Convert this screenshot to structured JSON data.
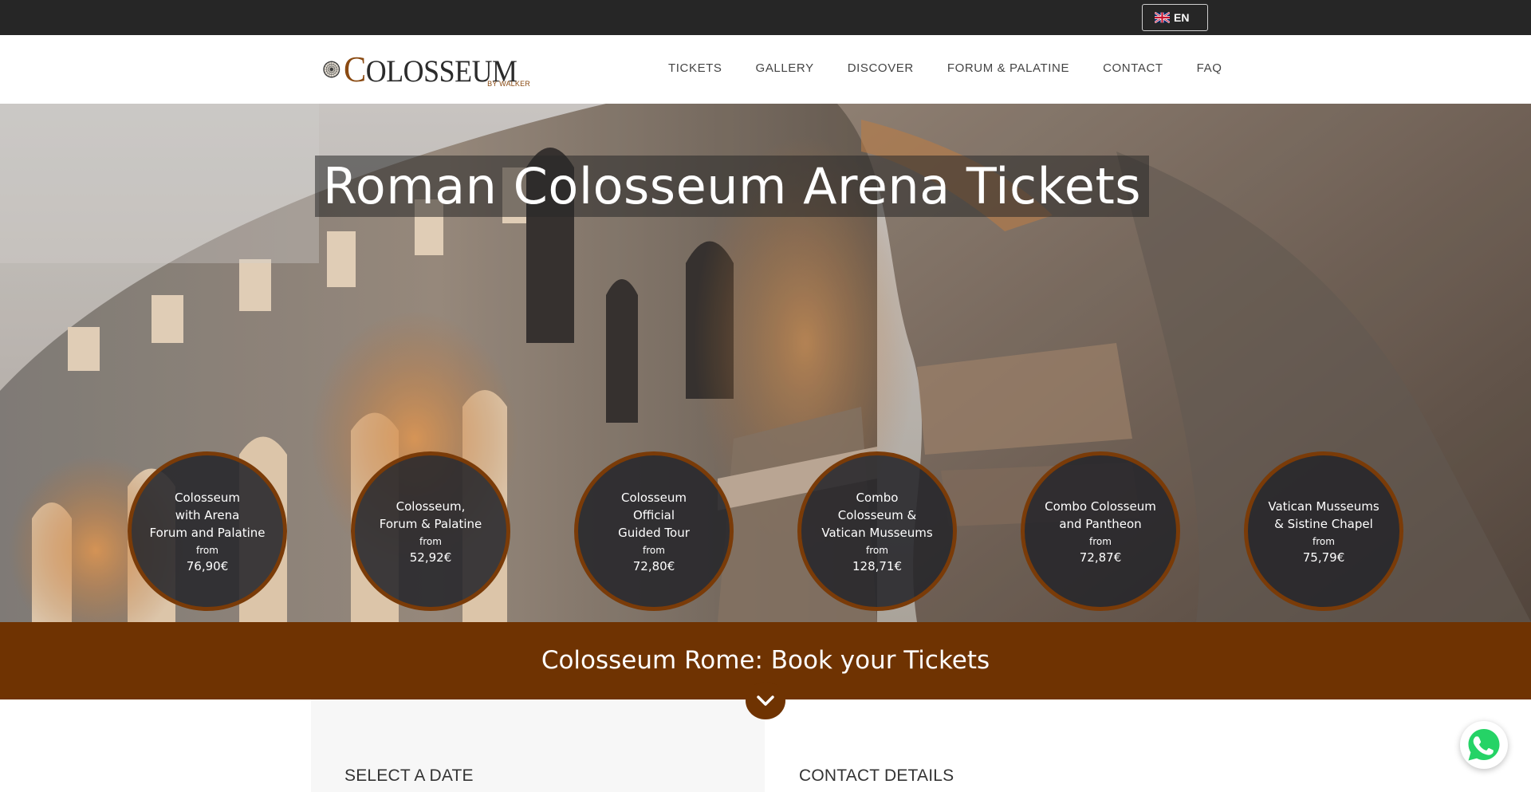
{
  "topbar": {
    "language": {
      "code": "EN",
      "flag_icon": "uk-flag-icon"
    }
  },
  "logo": {
    "initial": "C",
    "word_rest": "OLOSSEUM",
    "tagline": "BY WALKER",
    "brand_color": "#8a4a12"
  },
  "nav": {
    "items": [
      {
        "label": "TICKETS"
      },
      {
        "label": "GALLERY"
      },
      {
        "label": "DISCOVER"
      },
      {
        "label": "FORUM & PALATINE"
      },
      {
        "label": "CONTACT"
      },
      {
        "label": "FAQ"
      }
    ]
  },
  "hero": {
    "title": "Roman Colosseum Arena Tickets",
    "tickets": [
      {
        "title": "Colosseum\nwith Arena\nForum and Palatine",
        "from": "from",
        "price": "76,90€"
      },
      {
        "title": "Colosseum,\nForum & Palatine",
        "from": "from",
        "price": "52,92€"
      },
      {
        "title": "Colosseum\nOfficial\nGuided Tour",
        "from": "from",
        "price": "72,80€"
      },
      {
        "title": "Combo\nColosseum &\nVatican Musseums",
        "from": "from",
        "price": "128,71€"
      },
      {
        "title": "Combo Colosseum\nand Pantheon",
        "from": "from",
        "price": "72,87€"
      },
      {
        "title": "Vatican Musseums\n& Sistine Chapel",
        "from": "from",
        "price": "75,79€"
      }
    ]
  },
  "band": {
    "title": "Colosseum Rome: Book your Tickets",
    "color": "#6f3302",
    "scroll_icon": "chevron-down-icon"
  },
  "form": {
    "select_date_heading": "SELECT A DATE",
    "contact_heading": "CONTACT DETAILS"
  },
  "whatsapp": {
    "icon": "whatsapp-icon",
    "color": "#25d366"
  }
}
